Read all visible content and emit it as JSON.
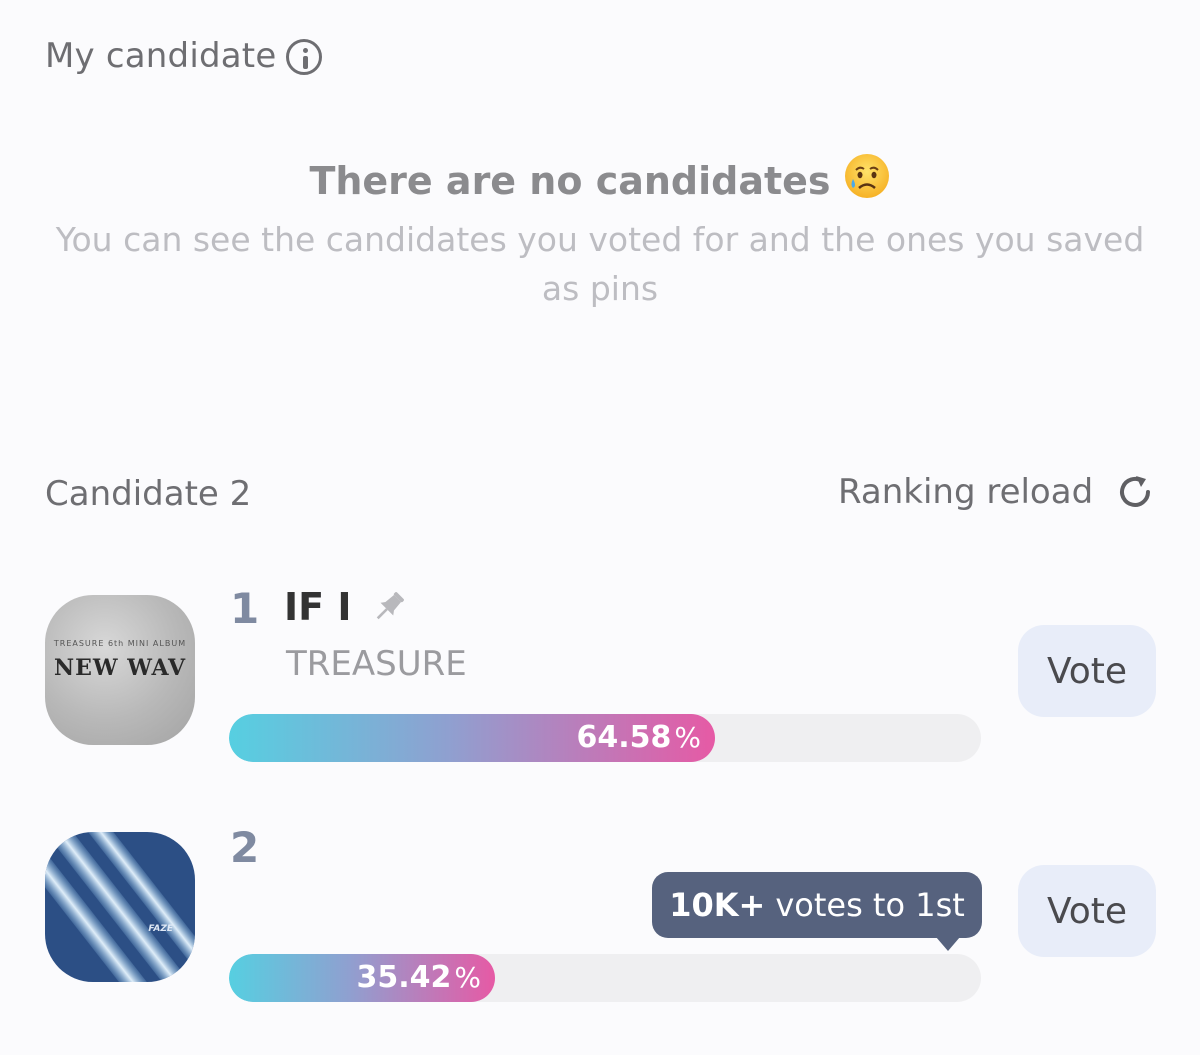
{
  "my_candidate": {
    "title": "My candidate",
    "empty_title": "There are no candidates",
    "empty_subtitle": "You can see the candidates you voted for and the ones you saved as pins"
  },
  "ranking": {
    "candidate_label": "Candidate 2",
    "reload_label": "Ranking reload",
    "items": [
      {
        "rank": "1",
        "song": "IF I",
        "artist": "TREASURE",
        "album_text": "NEW WAV",
        "album_small_text": "TREASURE 6th MINI ALBUM",
        "percent": "64.58",
        "percent_symbol": "%",
        "percent_value": 64.58,
        "vote_label": "Vote"
      },
      {
        "rank": "2",
        "song": "",
        "artist": "",
        "album_text": "FAZE",
        "percent": "35.42",
        "percent_symbol": "%",
        "percent_value": 35.42,
        "vote_label": "Vote",
        "tooltip_strong": "10K+",
        "tooltip_rest": "votes to 1st"
      }
    ]
  },
  "colors": {
    "bar_start": "#56cfe1",
    "bar_end": "#e65aa5",
    "vote_button_bg": "#e8edf9",
    "tooltip_bg": "#56627e"
  }
}
